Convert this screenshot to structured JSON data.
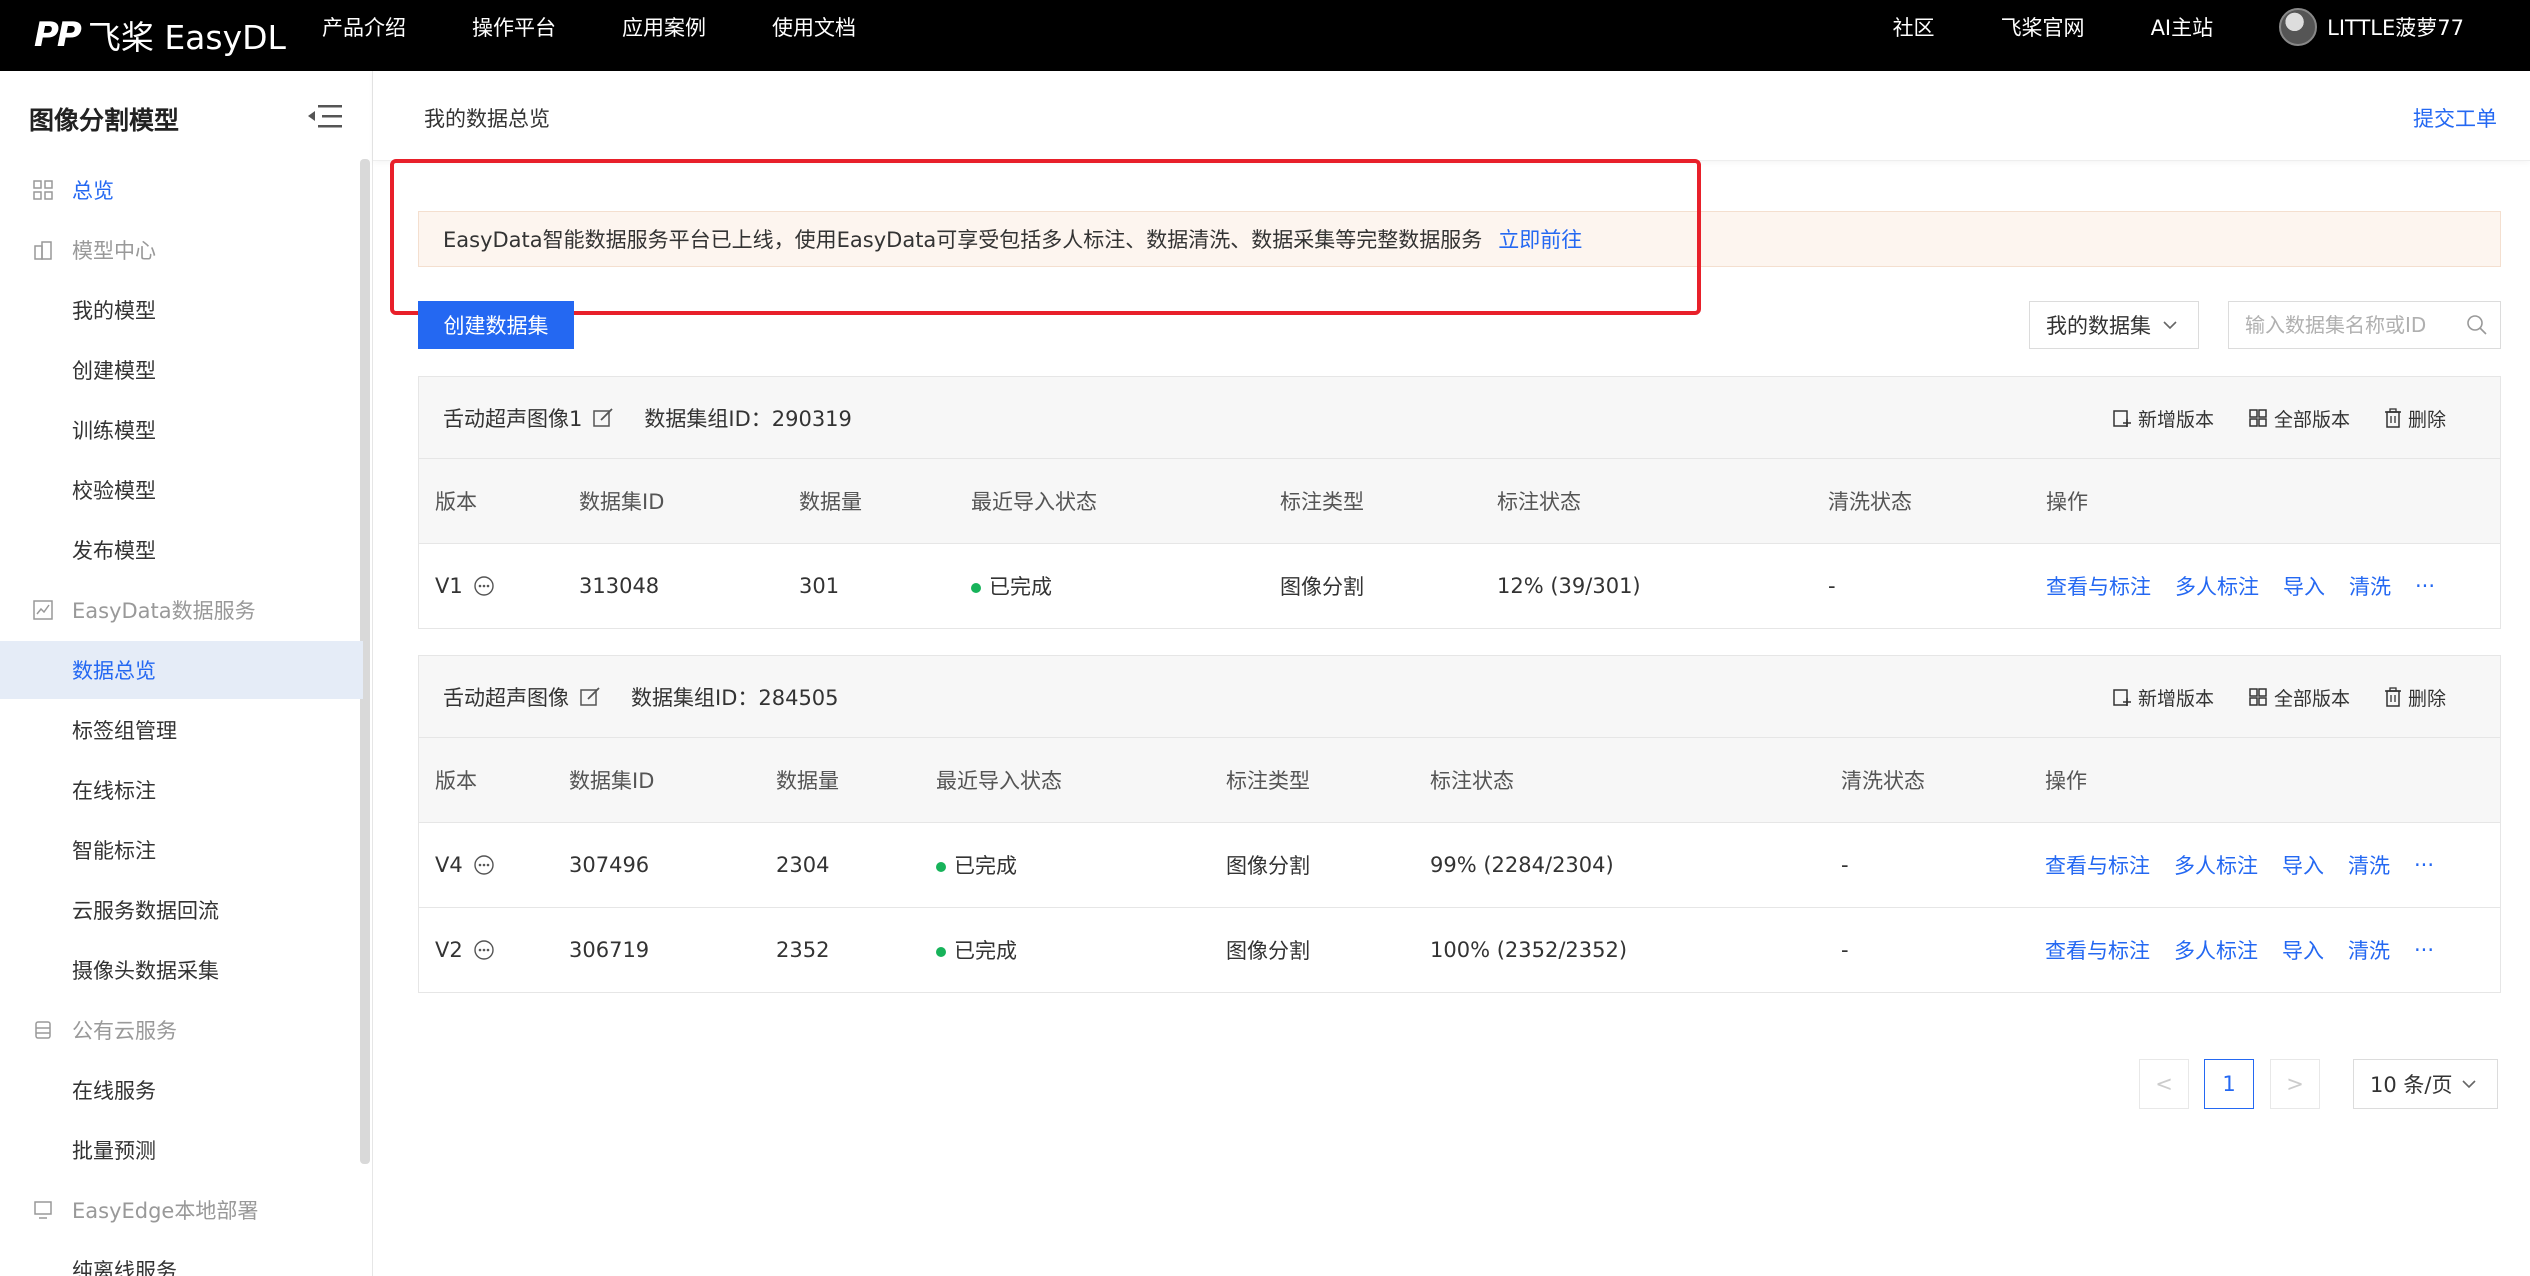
{
  "topbar": {
    "logo_mark": "PP",
    "logo_text": "飞桨 EasyDL",
    "nav": [
      "产品介绍",
      "操作平台",
      "应用案例",
      "使用文档"
    ],
    "right_links": [
      "社区",
      "飞桨官网",
      "AI主站"
    ],
    "username": "LITTLE菠萝77"
  },
  "sidebar": {
    "title": "图像分割模型",
    "items": [
      {
        "label": "总览",
        "kind": "group",
        "icon": "grid-icon"
      },
      {
        "label": "模型中心",
        "kind": "group",
        "icon": "building-icon"
      },
      {
        "label": "我的模型",
        "kind": "sub"
      },
      {
        "label": "创建模型",
        "kind": "sub"
      },
      {
        "label": "训练模型",
        "kind": "sub"
      },
      {
        "label": "校验模型",
        "kind": "sub"
      },
      {
        "label": "发布模型",
        "kind": "sub"
      },
      {
        "label": "EasyData数据服务",
        "kind": "group",
        "icon": "chart-icon"
      },
      {
        "label": "数据总览",
        "kind": "sub",
        "selected": true
      },
      {
        "label": "标签组管理",
        "kind": "sub"
      },
      {
        "label": "在线标注",
        "kind": "sub"
      },
      {
        "label": "智能标注",
        "kind": "sub"
      },
      {
        "label": "云服务数据回流",
        "kind": "sub"
      },
      {
        "label": "摄像头数据采集",
        "kind": "sub"
      },
      {
        "label": "公有云服务",
        "kind": "group",
        "icon": "database-icon"
      },
      {
        "label": "在线服务",
        "kind": "sub"
      },
      {
        "label": "批量预测",
        "kind": "sub"
      },
      {
        "label": "EasyEdge本地部署",
        "kind": "group",
        "icon": "device-icon"
      },
      {
        "label": "纯离线服务",
        "kind": "sub"
      }
    ]
  },
  "main": {
    "title": "我的数据总览",
    "ticket": "提交工单",
    "notice_text": "EasyData智能数据服务平台已上线，使用EasyData可享受包括多人标注、数据清洗、数据采集等完整数据服务",
    "notice_link": "立即前往",
    "create_button": "创建数据集",
    "filter_value": "我的数据集",
    "search_placeholder": "输入数据集名称或ID"
  },
  "card_actions": {
    "add_version": "新增版本",
    "all_versions": "全部版本",
    "delete": "删除"
  },
  "columns": [
    "版本",
    "数据集ID",
    "数据量",
    "最近导入状态",
    "标注类型",
    "标注状态",
    "清洗状态",
    "操作"
  ],
  "operations": [
    "查看与标注",
    "多人标注",
    "导入",
    "清洗",
    "···"
  ],
  "datasets": [
    {
      "name": "舌动超声图像1",
      "group_id": "数据集组ID：290319",
      "rows": [
        {
          "version": "V1",
          "id": "313048",
          "count": "301",
          "import_status": "已完成",
          "type": "图像分割",
          "label_status": "12% (39/301)",
          "clean_status": "-"
        }
      ]
    },
    {
      "name": "舌动超声图像",
      "group_id": "数据集组ID：284505",
      "rows": [
        {
          "version": "V4",
          "id": "307496",
          "count": "2304",
          "import_status": "已完成",
          "type": "图像分割",
          "label_status": "99% (2284/2304)",
          "clean_status": "-"
        },
        {
          "version": "V2",
          "id": "306719",
          "count": "2352",
          "import_status": "已完成",
          "type": "图像分割",
          "label_status": "100% (2352/2352)",
          "clean_status": "-"
        }
      ]
    }
  ],
  "pagination": {
    "prev": "<",
    "current": "1",
    "next": ">",
    "page_size": "10 条/页"
  },
  "colors": {
    "accent": "#2468f2",
    "success": "#17b35a",
    "highlight": "#e8202a",
    "notice_bg": "#fdf5ef"
  }
}
